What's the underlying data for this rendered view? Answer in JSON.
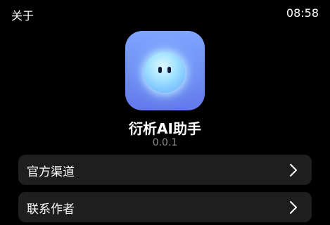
{
  "header": {
    "title": "关于",
    "time": "08:58"
  },
  "app": {
    "icon": "ai-assistant-orb-icon",
    "name": "衍析AI助手",
    "version": "0.0.1"
  },
  "menu": {
    "items": [
      {
        "label": "官方渠道",
        "icon": "chevron-right-icon"
      },
      {
        "label": "联系作者",
        "icon": "chevron-right-icon"
      }
    ]
  },
  "colors": {
    "background": "#000000",
    "card": "#1e1e1e",
    "version_text": "#8a8a8a",
    "icon_gradient_top": "#7fa5ff",
    "icon_gradient_bottom": "#6478ea"
  }
}
